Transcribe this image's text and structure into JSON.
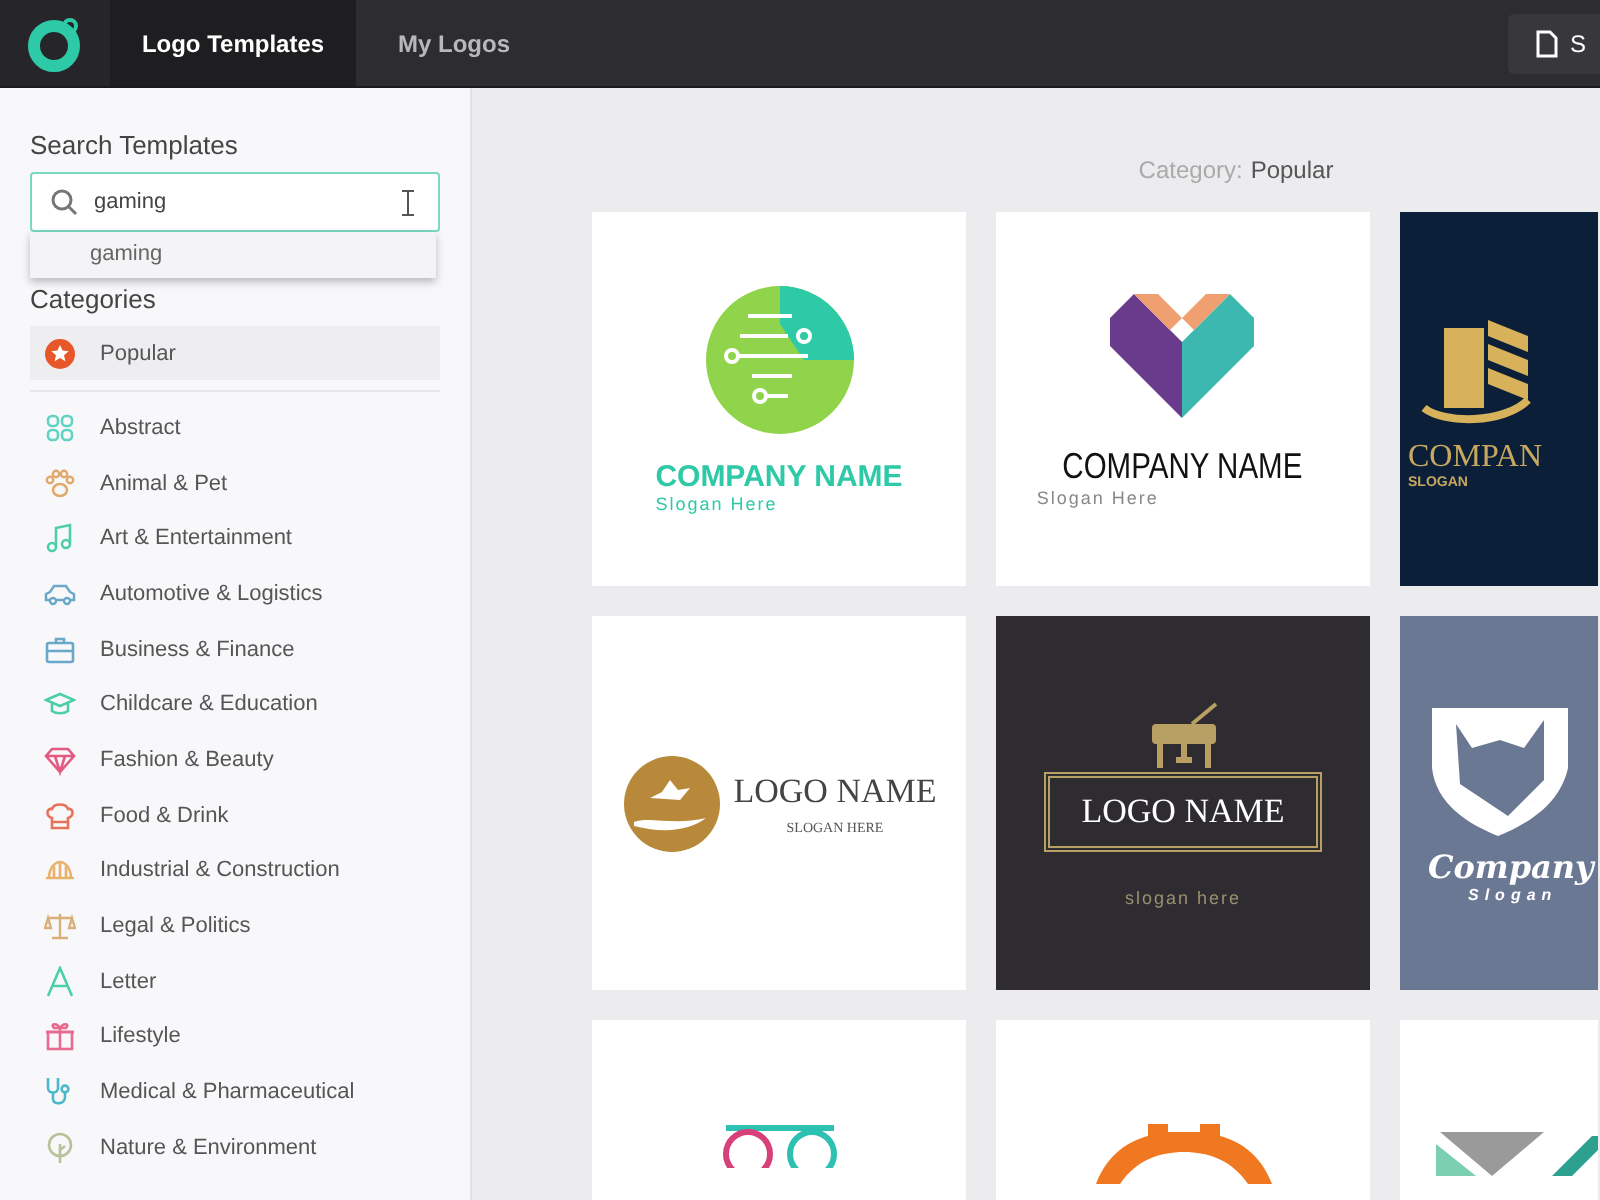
{
  "topbar": {
    "tabs": [
      {
        "label": "Logo Templates",
        "selected": true
      },
      {
        "label": "My Logos",
        "selected": false
      }
    ],
    "action_button": {
      "label": "S"
    }
  },
  "sidebar": {
    "search_heading": "Search Templates",
    "search": {
      "value": "gaming"
    },
    "suggestions": [
      "gaming"
    ],
    "categories_heading": "Categories",
    "categories": [
      {
        "label": "Popular",
        "kind": "star",
        "color": "#e8572a",
        "selected": true
      },
      {
        "label": "Abstract",
        "kind": "abstract",
        "color": "#5fd3c4",
        "selected": false
      },
      {
        "label": "Animal & Pet",
        "kind": "paw",
        "color": "#e0a86a",
        "selected": false
      },
      {
        "label": "Art & Entertainment",
        "kind": "music",
        "color": "#4ccfa9",
        "selected": false
      },
      {
        "label": "Automotive & Logistics",
        "kind": "car",
        "color": "#6aa7c9",
        "selected": false
      },
      {
        "label": "Business & Finance",
        "kind": "briefcase",
        "color": "#6aa7c9",
        "selected": false
      },
      {
        "label": "Childcare & Education",
        "kind": "cap",
        "color": "#4ccfa9",
        "selected": false
      },
      {
        "label": "Fashion & Beauty",
        "kind": "diamond",
        "color": "#e25a7f",
        "selected": false
      },
      {
        "label": "Food & Drink",
        "kind": "chef",
        "color": "#e8725a",
        "selected": false
      },
      {
        "label": "Industrial & Construction",
        "kind": "helmet",
        "color": "#e8b26a",
        "selected": false
      },
      {
        "label": "Legal & Politics",
        "kind": "scales",
        "color": "#d9b07a",
        "selected": false
      },
      {
        "label": "Letter",
        "kind": "letter",
        "color": "#4ccfa9",
        "selected": false
      },
      {
        "label": "Lifestyle",
        "kind": "gift",
        "color": "#e86a8f",
        "selected": false
      },
      {
        "label": "Medical & Pharmaceutical",
        "kind": "stethoscope",
        "color": "#4cb8c9",
        "selected": false
      },
      {
        "label": "Nature & Environment",
        "kind": "tree",
        "color": "#b8c29a",
        "selected": false
      }
    ]
  },
  "main": {
    "category_label": "Category:",
    "category_value": "Popular",
    "templates": [
      {
        "kind": "circuit",
        "title": "COMPANY NAME",
        "slogan": "Slogan Here"
      },
      {
        "kind": "heart",
        "title": "COMPANY NAME",
        "slogan": "Slogan Here"
      },
      {
        "kind": "building",
        "title": "COMPAN",
        "slogan": "SLOGAN"
      },
      {
        "kind": "hand",
        "title": "LOGO NAME",
        "slogan": "SLOGAN HERE"
      },
      {
        "kind": "piano",
        "title": "LOGO NAME",
        "slogan": "slogan here"
      },
      {
        "kind": "wolf",
        "title": "Company",
        "slogan": "Slogan"
      },
      {
        "kind": "glasses"
      },
      {
        "kind": "gear"
      },
      {
        "kind": "chevron"
      }
    ]
  }
}
